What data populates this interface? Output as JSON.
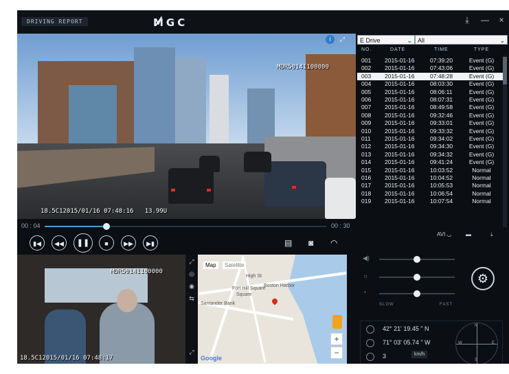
{
  "window": {
    "title_tab": "DRIVING REPORT",
    "brand": "MGC",
    "download_icon": "download-icon",
    "minimize": "—",
    "close": "×"
  },
  "main_video": {
    "osd_top": "MDR50141100000",
    "osd_bottom": "18.5C12015/01/16 07:48:16   13.99U",
    "time_current": "00 : 04",
    "time_total": "00 : 30",
    "seek_progress": 0.22
  },
  "controls": {
    "prev": "prev-icon",
    "rewind": "rewind-icon",
    "pause": "pause-icon",
    "stop": "stop-icon",
    "forward": "forward-icon",
    "next": "next-icon",
    "snapshot": "camera-icon",
    "speed": "speedometer-icon"
  },
  "cabin_video": {
    "osd_top": "MDR50141100000",
    "osd_bottom": "18.5C12015/01/16 07:48:17"
  },
  "map": {
    "tab_map": "Map",
    "tab_satellite": "Satellite",
    "labels": [
      "High St",
      "Boston Harbor",
      "Fort Hill Square",
      "Santander Bank",
      "Square"
    ],
    "zoom_in": "+",
    "zoom_out": "−",
    "brand": "Google"
  },
  "file_browser": {
    "drive": "E Drive",
    "filter": "All",
    "columns": [
      "NO.",
      "DATE",
      "TIME",
      "TYPE"
    ],
    "selected_index": 2,
    "rows": [
      {
        "no": "001",
        "date": "2015-01-16",
        "time": "07:39:20",
        "type": "Event (G)"
      },
      {
        "no": "002",
        "date": "2015-01-16",
        "time": "07:43:06",
        "type": "Event (G)"
      },
      {
        "no": "003",
        "date": "2015-01-16",
        "time": "07:48:28",
        "type": "Event (G)"
      },
      {
        "no": "004",
        "date": "2015-01-16",
        "time": "08:03:30",
        "type": "Event (G)"
      },
      {
        "no": "005",
        "date": "2015-01-16",
        "time": "08:06:11",
        "type": "Event (G)"
      },
      {
        "no": "006",
        "date": "2015-01-16",
        "time": "08:07:31",
        "type": "Event (G)"
      },
      {
        "no": "007",
        "date": "2015-01-16",
        "time": "08:49:58",
        "type": "Event (G)"
      },
      {
        "no": "008",
        "date": "2015-01-16",
        "time": "09:32:46",
        "type": "Event (G)"
      },
      {
        "no": "009",
        "date": "2015-01-16",
        "time": "09:33:01",
        "type": "Event (G)"
      },
      {
        "no": "010",
        "date": "2015-01-16",
        "time": "09:33:32",
        "type": "Event (G)"
      },
      {
        "no": "011",
        "date": "2015-01-16",
        "time": "09:34:02",
        "type": "Event (G)"
      },
      {
        "no": "012",
        "date": "2015-01-16",
        "time": "09:34:30",
        "type": "Event (G)"
      },
      {
        "no": "013",
        "date": "2015-01-16",
        "time": "09:34:32",
        "type": "Event (G)"
      },
      {
        "no": "014",
        "date": "2015-01-16",
        "time": "09:41:24",
        "type": "Event (G)"
      },
      {
        "no": "015",
        "date": "2015-01-16",
        "time": "10:03:52",
        "type": "Normal"
      },
      {
        "no": "016",
        "date": "2015-01-16",
        "time": "10:04:52",
        "type": "Normal"
      },
      {
        "no": "017",
        "date": "2015-01-16",
        "time": "10:05:53",
        "type": "Normal"
      },
      {
        "no": "018",
        "date": "2015-01-16",
        "time": "10:06:54",
        "type": "Normal"
      },
      {
        "no": "019",
        "date": "2015-01-16",
        "time": "10:07:54",
        "type": "Normal"
      }
    ],
    "export_avi": "AVI",
    "export_folder_icon": "folder-icon",
    "export_download_icon": "download-icon"
  },
  "settings": {
    "volume_level": 0.5,
    "brightness_level": 0.5,
    "speed_level": 0.5,
    "slow_label": "SLOW",
    "fast_label": "FAST"
  },
  "gps": {
    "latitude": "42° 21'  19.45 \" N",
    "longitude": "71° 03'  05.74 \" W",
    "speed": "3",
    "speed_unit": "km/h",
    "compass": {
      "n": "N",
      "e": "E",
      "s": "S",
      "w": "W"
    }
  },
  "colors": {
    "accent": "#4a9ed8",
    "background": "#0b0f14",
    "selected_row": "#f1f4f6"
  }
}
